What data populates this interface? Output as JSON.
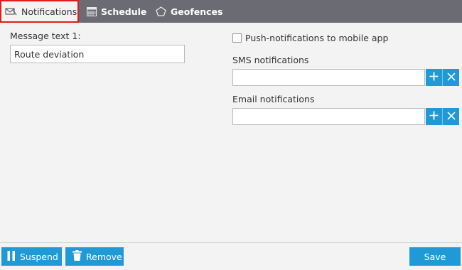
{
  "tabs": [
    {
      "label": "Notifications",
      "icon": "notifications-icon"
    },
    {
      "label": "Schedule",
      "icon": "calendar-icon"
    },
    {
      "label": "Geofences",
      "icon": "pentagon-icon"
    }
  ],
  "left": {
    "message_label": "Message text 1:",
    "message_value": "Route deviation"
  },
  "right": {
    "push_label": "Push-notifications to mobile app",
    "sms_label": "SMS notifications",
    "sms_value": "",
    "email_label": "Email notifications",
    "email_value": ""
  },
  "footer": {
    "suspend_label": "Suspend",
    "remove_label": "Remove",
    "save_label": "Save"
  },
  "colors": {
    "accent": "#1f9ad6",
    "tabbar": "#6b6b73",
    "active_tab_border": "#e21b1b",
    "background": "#f3f3f3"
  }
}
